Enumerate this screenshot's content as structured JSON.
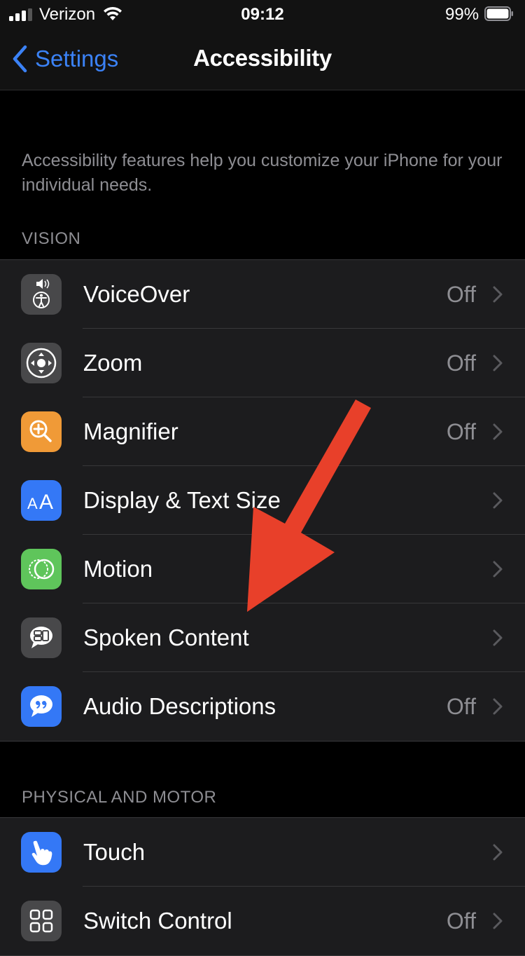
{
  "status_bar": {
    "carrier": "Verizon",
    "time": "09:12",
    "battery_percent": "99%",
    "signal_bars_active": 3,
    "signal_bars_total": 4,
    "battery_level": 0.99
  },
  "nav": {
    "back_label": "Settings",
    "title": "Accessibility"
  },
  "description": "Accessibility features help you customize your iPhone for your individual needs.",
  "sections": [
    {
      "header": "VISION",
      "items": [
        {
          "label": "VoiceOver",
          "value": "Off",
          "icon": "voiceover-icon",
          "icon_color": "#48484a"
        },
        {
          "label": "Zoom",
          "value": "Off",
          "icon": "zoom-icon",
          "icon_color": "#48484a"
        },
        {
          "label": "Magnifier",
          "value": "Off",
          "icon": "magnifier-icon",
          "icon_color": "#f09a37"
        },
        {
          "label": "Display & Text Size",
          "value": "",
          "icon": "text-size-icon",
          "icon_color": "#3478f6"
        },
        {
          "label": "Motion",
          "value": "",
          "icon": "motion-icon",
          "icon_color": "#5fc55b"
        },
        {
          "label": "Spoken Content",
          "value": "",
          "icon": "spoken-content-icon",
          "icon_color": "#48484a"
        },
        {
          "label": "Audio Descriptions",
          "value": "Off",
          "icon": "audio-descriptions-icon",
          "icon_color": "#3478f6"
        }
      ]
    },
    {
      "header": "PHYSICAL AND MOTOR",
      "items": [
        {
          "label": "Touch",
          "value": "",
          "icon": "touch-icon",
          "icon_color": "#3478f6"
        },
        {
          "label": "Switch Control",
          "value": "Off",
          "icon": "switch-control-icon",
          "icon_color": "#48484a"
        }
      ]
    }
  ],
  "annotation": {
    "type": "arrow",
    "color": "#e8402a",
    "points_to": "Spoken Content"
  },
  "colors": {
    "accent": "#3b82f6",
    "background": "#000000",
    "cell_background": "#1c1c1e",
    "secondary_text": "#8e8e93"
  }
}
